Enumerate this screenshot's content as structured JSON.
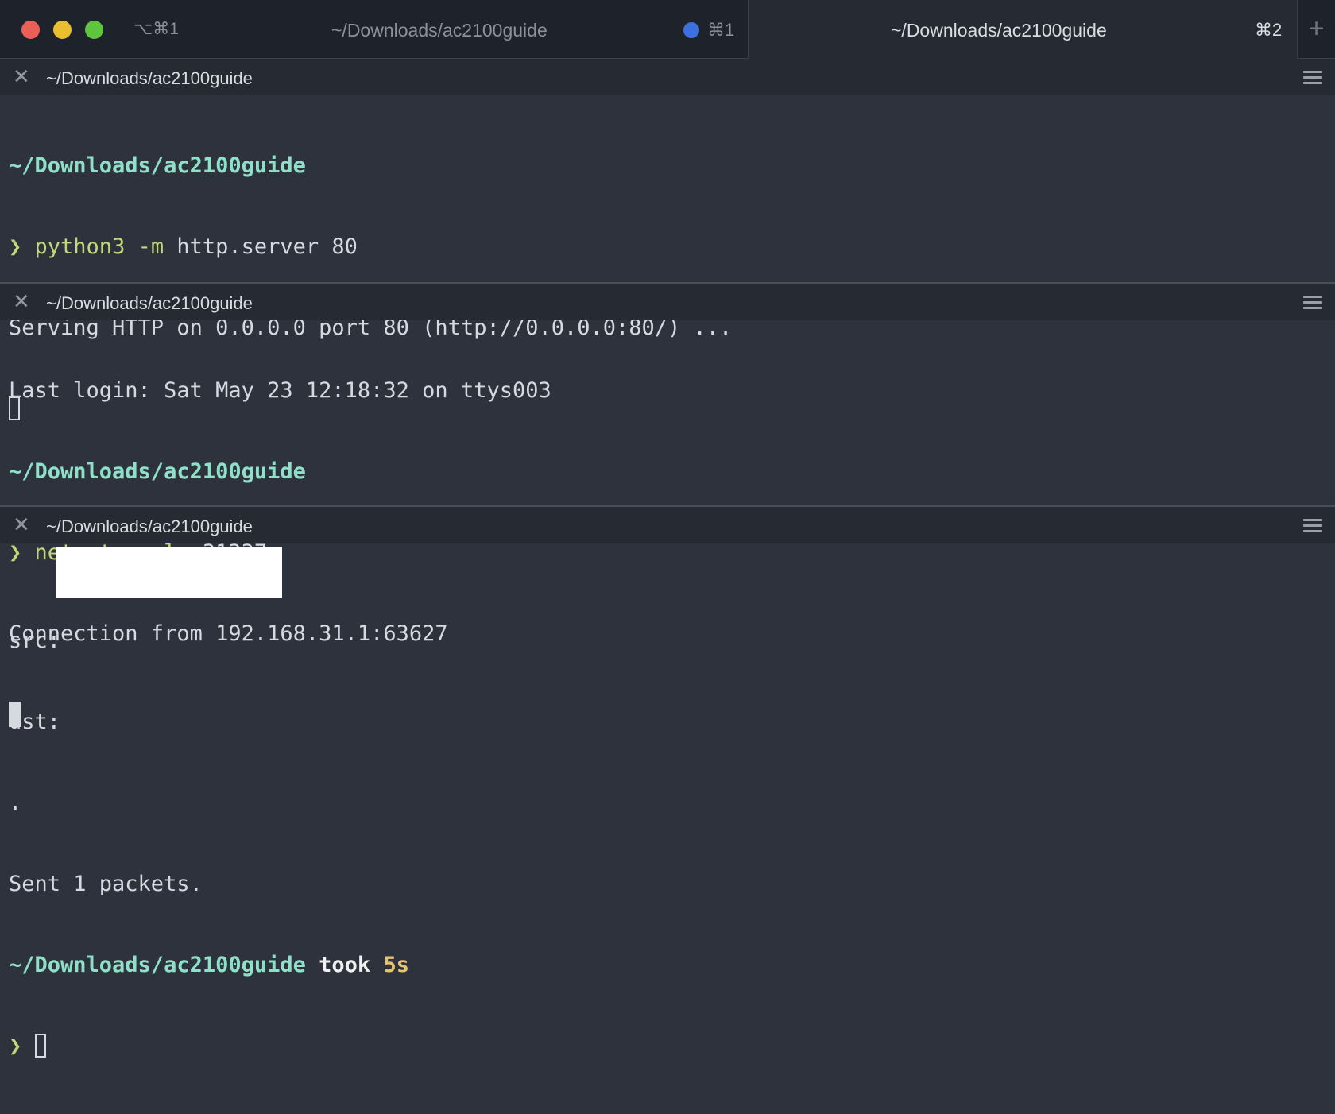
{
  "window": {
    "shortcut": "⌥⌘1",
    "controls": [
      "close",
      "minimize",
      "maximize"
    ]
  },
  "tabs": [
    {
      "title": "~/Downloads/ac2100guide",
      "shortcut": "⌘1",
      "activity_dot_color": "#3d6fe0",
      "active": false
    },
    {
      "title": "~/Downloads/ac2100guide",
      "shortcut": "⌘2",
      "active": true
    }
  ],
  "new_tab_label": "+",
  "colors": {
    "path": "#8ee0c8",
    "command": "#c3d87a",
    "duration": "#e8c46b",
    "background": "#2e323c"
  },
  "panes": [
    {
      "title": "~/Downloads/ac2100guide",
      "lines": {
        "prompt_path": "~/Downloads/ac2100guide",
        "prompt_arrow": "❯",
        "cmd": "python3 -m",
        "args": "http.server 80",
        "output": "Serving HTTP on 0.0.0.0 port 80 (http://0.0.0.0:80/) ..."
      }
    },
    {
      "title": "~/Downloads/ac2100guide",
      "lines": {
        "last_login": "Last login: Sat May 23 12:18:32 on ttys003",
        "prompt_path": "~/Downloads/ac2100guide",
        "prompt_arrow": "❯",
        "cmd": "netcat -nvlp",
        "args": "31337",
        "output": "Connection from 192.168.31.1:63627"
      }
    },
    {
      "title": "~/Downloads/ac2100guide",
      "lines": {
        "src_label": "src:",
        "dst_label": "dst:",
        "dot": ".",
        "sent": "Sent 1 packets.",
        "prompt_path": "~/Downloads/ac2100guide",
        "took_label": "took",
        "duration": "5s",
        "prompt_arrow": "❯"
      }
    }
  ]
}
